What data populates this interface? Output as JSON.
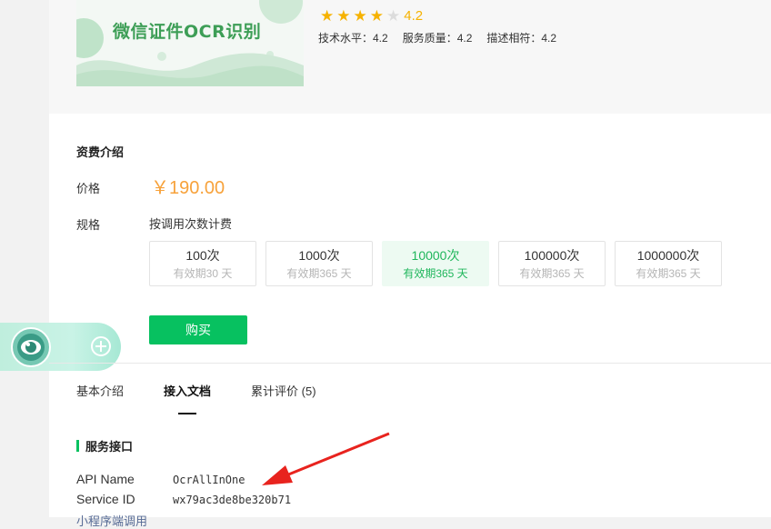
{
  "product": {
    "banner_text": "微信证件OCR识别",
    "rating": "4.2",
    "stars_on": 4,
    "stars_total": 5,
    "subratings": [
      {
        "label": "技术水平：4.2"
      },
      {
        "label": "服务质量：4.2"
      },
      {
        "label": "描述相符：4.2"
      }
    ]
  },
  "pricing": {
    "section_title": "资费介绍",
    "price_label": "价格",
    "price": "￥190.00",
    "spec_label": "规格",
    "spec_type": "按调用次数计费",
    "options": [
      {
        "count": "100次",
        "valid": "有效期30 天"
      },
      {
        "count": "1000次",
        "valid": "有效期365 天"
      },
      {
        "count": "10000次",
        "valid": "有效期365 天"
      },
      {
        "count": "100000次",
        "valid": "有效期365 天"
      },
      {
        "count": "1000000次",
        "valid": "有效期365 天"
      }
    ],
    "selected_index": 2,
    "buy_label": "购买"
  },
  "tabs": [
    {
      "label": "基本介绍"
    },
    {
      "label": "接入文档"
    },
    {
      "label": "累计评价 (5)"
    }
  ],
  "active_tab": 1,
  "service": {
    "title": "服务接口",
    "api_name_key": "API Name",
    "api_name_value": "OcrAllInOne",
    "service_id_key": "Service ID",
    "service_id_value": "wx79ac3de8be320b71",
    "cut_link": "小程序端调用"
  },
  "colors": {
    "accent_green": "#07c160",
    "price_orange": "#f7a23b",
    "star_gold": "#f6b200",
    "arrow_red": "#e8231e"
  }
}
